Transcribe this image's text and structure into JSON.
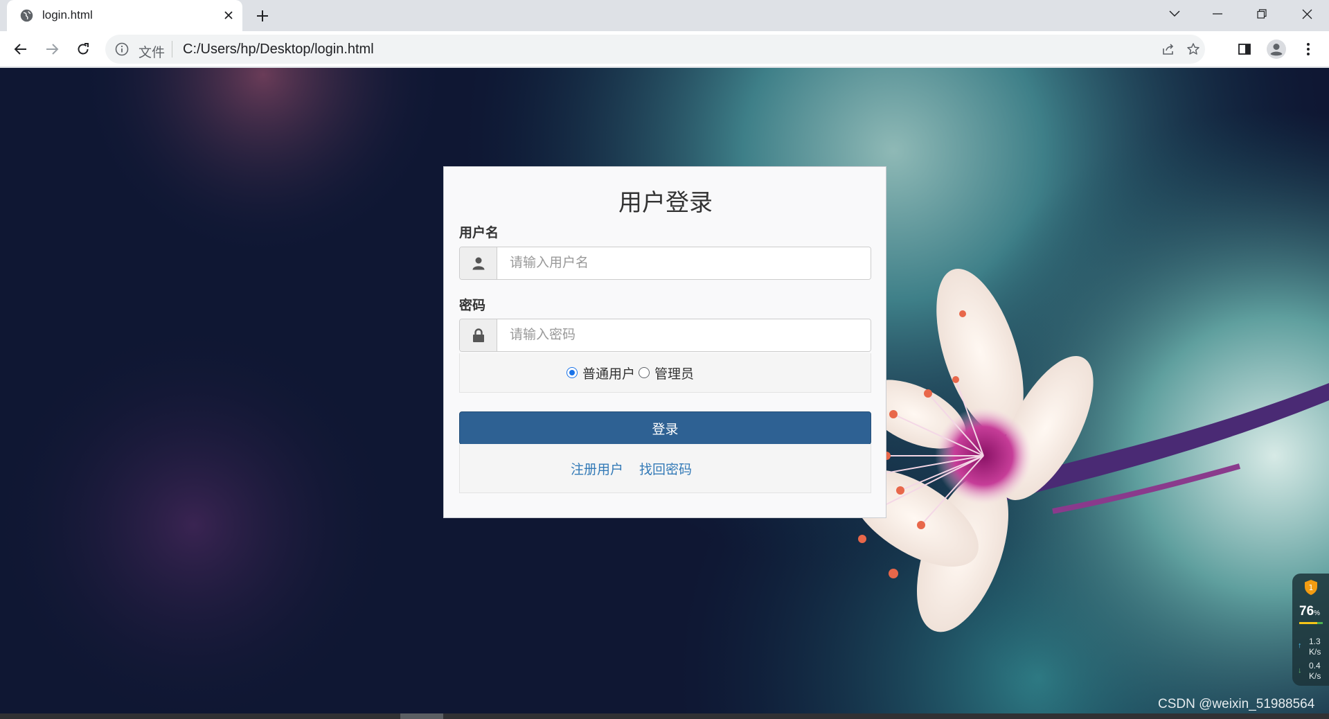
{
  "browser": {
    "tab_title": "login.html",
    "address_scheme_label": "文件",
    "address_url": "C:/Users/hp/Desktop/login.html"
  },
  "login": {
    "title": "用户登录",
    "username_label": "用户名",
    "username_placeholder": "请输入用户名",
    "password_label": "密码",
    "password_placeholder": "请输入密码",
    "roles": [
      {
        "label": "普通用户",
        "checked": true
      },
      {
        "label": "管理员",
        "checked": false
      }
    ],
    "submit_label": "登录",
    "links": [
      "注册用户",
      "找回密码"
    ],
    "colors": {
      "button": "#2e6193",
      "link": "#337ab7"
    }
  },
  "system_monitor": {
    "shield_count": "1",
    "cpu_percent": "76",
    "cpu_percent_unit": "%",
    "upload_speed": "1.3",
    "download_speed": "0.4",
    "speed_unit": "K/s",
    "icons": [
      "shield-icon",
      "up-arrow-icon",
      "down-arrow-icon"
    ]
  },
  "watermark": "CSDN @weixin_51988564"
}
